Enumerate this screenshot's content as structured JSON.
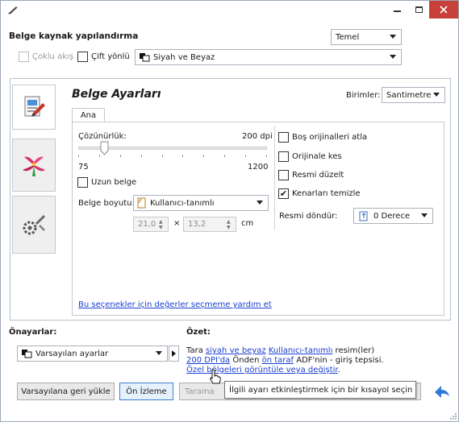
{
  "colors": {
    "accent": "#1a3fd1",
    "close_button": "#c7403a",
    "back_arrow": "#2f7ad8"
  },
  "header": {
    "title": "Belge kaynak yapılandırma",
    "mode_select": "Temel"
  },
  "options": {
    "multi_stream_label": "Çoklu akış",
    "duplex_label": "Çift yönlü",
    "color_mode": "Siyah ve Beyaz"
  },
  "panel": {
    "title": "Belge Ayarları",
    "units_label": "Birimler:",
    "units_value": "Santimetre",
    "tab_label": "Ana",
    "resolution_label": "Çözünürlük:",
    "resolution_value": "200 dpi",
    "resolution_min": "75",
    "resolution_max": "1200",
    "resolution_position": 0.14,
    "long_document_label": "Uzun belge",
    "document_size_label": "Belge boyutu:",
    "document_size_value": "Kullanıcı-tanımlı",
    "width_value": "21,0",
    "height_value": "13,2",
    "times_sign": "×",
    "size_unit": "cm",
    "skip_blank_label": "Boş orijinalleri atla",
    "crop_label": "Orijinale kes",
    "straighten_label": "Resmi düzelt",
    "edge_clean_label": "Kenarları temizle",
    "rotate_label": "Resmi döndür:",
    "rotate_value": "0 Derece",
    "help_link": "Bu seçenekler için değerler seçmeme yardım et",
    "checked": {
      "skip_blank": false,
      "crop": false,
      "straighten": false,
      "edge_clean": true,
      "long_document": false
    }
  },
  "presets": {
    "label": "Önayarlar:",
    "value": "Varsayılan ayarlar"
  },
  "summary": {
    "label": "Özet:",
    "line1_prefix": "Tara",
    "line1_link1": "siyah ve beyaz",
    "line1_link2": "Kullanıcı-tanımlı",
    "line1_suffix": "resim(ler)",
    "line2_link1": "200 DPI'da",
    "line2_text1": "Önden",
    "line2_link2": "ön taraf",
    "line2_text2": "ADF'nin - giriş tepsisi.",
    "line3_link": "Özel bölgeleri görüntüle veya değiştir",
    "line3_suffix": "."
  },
  "buttons": {
    "reset": "Varsayılana geri yükle",
    "preview": "Ön İzleme",
    "scan": "Tarama"
  },
  "tooltip": "İlgili ayarı etkinleştirmek için bir kısayol seçin"
}
